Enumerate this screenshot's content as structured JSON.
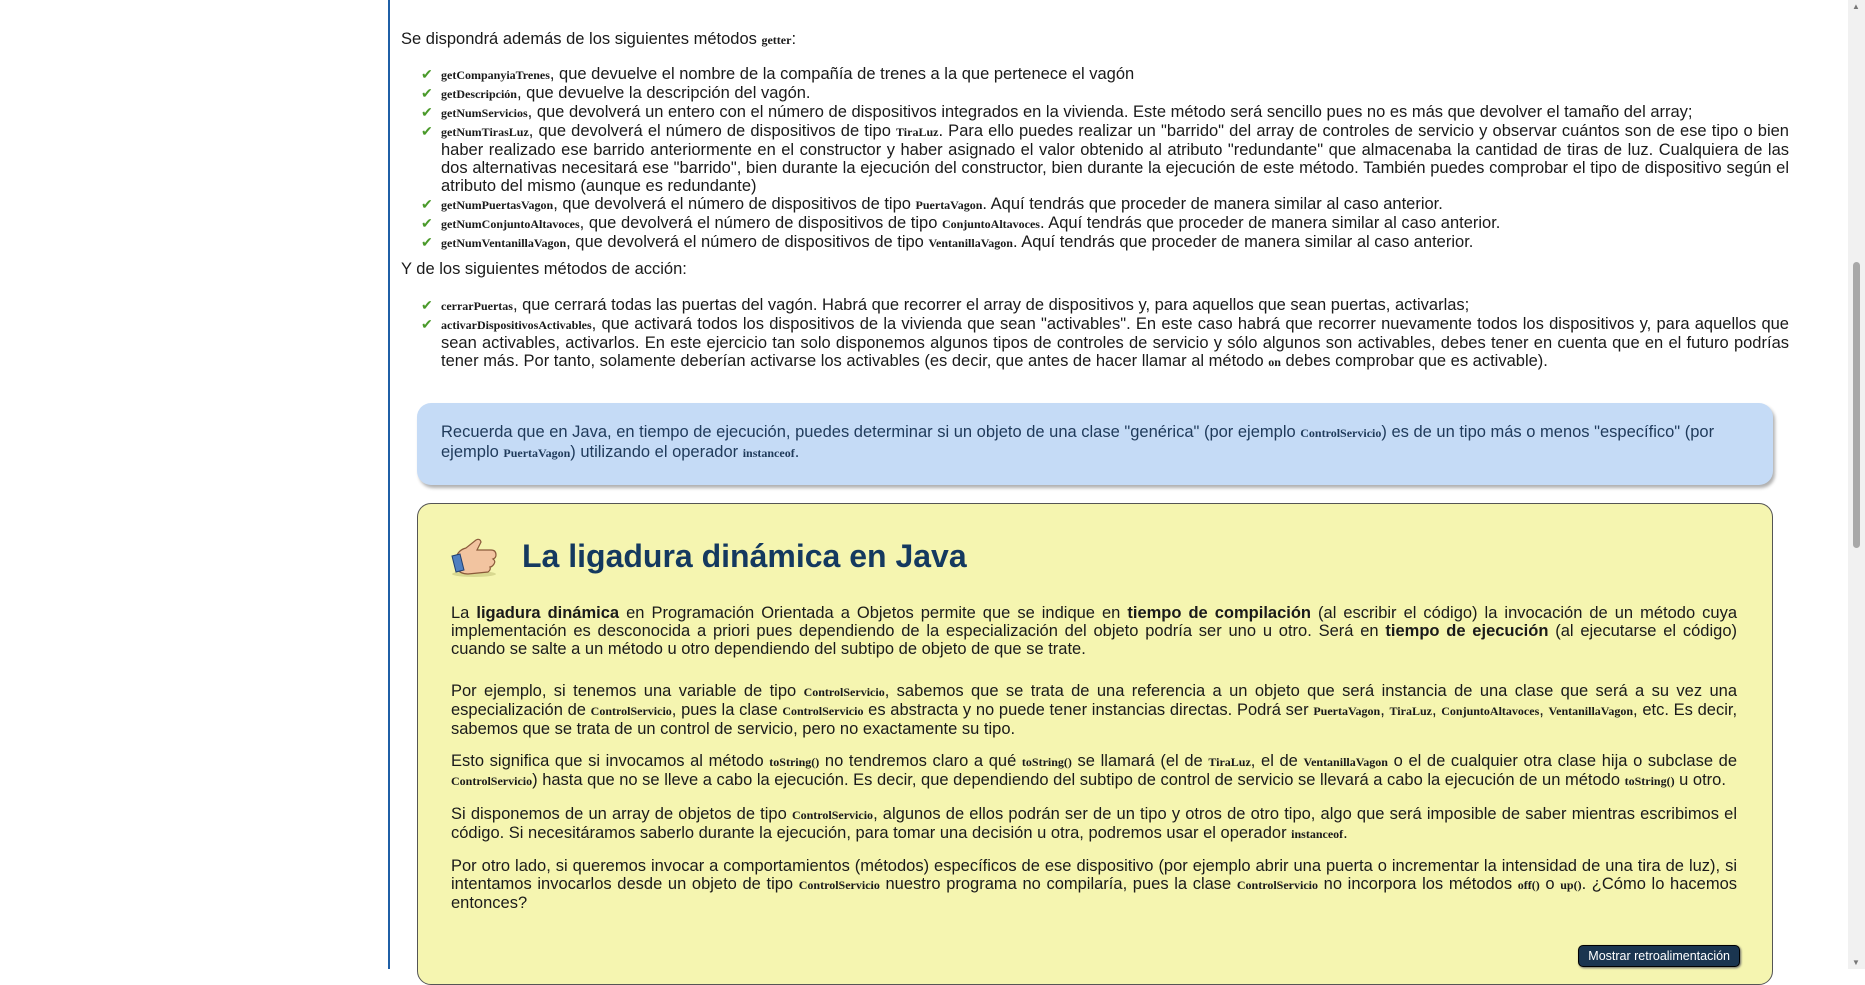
{
  "intro": {
    "before": "Se dispondrá además de los siguientes métodos ",
    "code": "getter",
    "after": ":"
  },
  "getters": [
    {
      "name": "getCompanyiaTrenes",
      "text": ", que devuelve el nombre de la compañía de  trenes a la que pertenece el vagón"
    },
    {
      "name": "getDescripción",
      "text": ", que devuelve la descripción del vagón."
    },
    {
      "name": "getNumServicios",
      "text": ", que devolverá un entero con el número de dispositivos integrados en la vivienda. Este método será sencillo pues no es más que devolver el tamaño del array;"
    },
    {
      "name": "getNumTirasLuz",
      "text": ", que devolverá el número de dispositivos de tipo ",
      "code2": "TiraLuz",
      "text2": ". Para ello puedes realizar un \"barrido\" del array de controles de servicio y observar cuántos son de ese tipo o bien haber realizado ese barrido anteriormente en el constructor y haber asignado el valor obtenido al atributo \"redundante\" que almacenaba la cantidad de tiras de luz. Cualquiera de las dos alternativas necesitará ese \"barrido\", bien durante la ejecución del constructor, bien durante la ejecución de este método. También puedes comprobar el tipo de dispositivo según el atributo del mismo (aunque es redundante)"
    },
    {
      "name": "getNumPuertasVagon",
      "text": ", que devolverá el número de dispositivos de tipo ",
      "code2": "PuertaVagon",
      "text2": ". Aquí tendrás que proceder de manera similar al caso anterior."
    },
    {
      "name": "getNumConjuntoAltavoces",
      "text": ", que devolverá el número de dispositivos de tipo ",
      "code2": "ConjuntoAltavoces",
      "text2": ". Aquí tendrás que proceder de manera similar al caso anterior."
    },
    {
      "name": "getNumVentanillaVagon",
      "text": ", que devolverá el número de dispositivos de tipo ",
      "code2": "VentanillaVagon",
      "text2": ". Aquí tendrás que proceder de manera similar al caso anterior."
    }
  ],
  "intro2": "Y de los siguientes métodos de acción:",
  "actions": [
    {
      "name": "cerrarPuertas",
      "text": ", que cerrará todas las puertas del vagón. Habrá que recorrer el array de dispositivos y, para  aquellos que sean puertas, activarlas;"
    },
    {
      "name": "activarDispositivosActivables",
      "text": ", que activará todos los dispositivos de la vivienda que sean \"activables\". En este caso habrá que recorrer nuevamente todos los dispositivos y, para aquellos que sean activables, activarlos. En este  ejercicio tan solo disponemos algunos tipos de controles de servicio y sólo algunos son activables, debes tener en cuenta que en el futuro podrías tener más. Por tanto, solamente deberían activarse los activables (es decir, que antes de hacer llamar al método ",
      "code2": "on",
      "text2": " debes comprobar que es activable)."
    }
  ],
  "note": {
    "t1": "Recuerda que en Java, en tiempo de ejecución, puedes determinar si un objeto de una clase \"genérica\" (por ejemplo ",
    "c1": "ControlServicio",
    "t2": ") es de un tipo más o menos \"específico\" (por ejemplo ",
    "c2": "PuertaVagon",
    "t3": ") utilizando el operador ",
    "c3": "instanceof",
    "t4": "."
  },
  "box": {
    "title": "La ligadura dinámica en Java",
    "p1": {
      "t1": "La ",
      "b1": "ligadura dinámica",
      "t2": " en Programación Orientada a Objetos permite que se indique en ",
      "b2": "tiempo de compilación",
      "t3": " (al escribir el código) la invocación de un método cuya implementación es desconocida a priori pues dependiendo de la especialización del objeto podría ser uno u otro. Será en ",
      "b3": "tiempo de ejecución",
      "t4": " (al ejecutarse el código) cuando se salte a un método u otro dependiendo del subtipo de objeto de que se trate."
    },
    "p2": {
      "t1": "Por ejemplo, si tenemos una variable de tipo ",
      "c1": "ControlServicio",
      "t2": ", sabemos que se trata de una referencia a un objeto que será instancia de una clase que será a su vez una especialización de ",
      "c2": "ControlServicio",
      "t3": ", pues la clase ",
      "c3": "ControlServicio",
      "t4": " es abstracta y no puede tener instancias directas. Podrá ser ",
      "c4": "PuertaVagon",
      "t5": ", ",
      "c5": "TiraLuz",
      "t6": ", ",
      "c6": "ConjuntoAltavoces",
      "t7": ", ",
      "c7": "VentanillaVagon",
      "t8": ", etc. Es decir, sabemos que se trata de un control de servicio, pero no exactamente su tipo."
    },
    "p3": {
      "t1": "Esto significa que si invocamos al método ",
      "c1": "toString()",
      "t2": " no tendremos claro a qué ",
      "c2": "toString()",
      "t3": " se llamará (el de ",
      "c3": "TiraLuz",
      "t4": ", el de ",
      "c4": "VentanillaVagon",
      "t5": " o el de cualquier otra clase hija o subclase de ",
      "c5": "ControlServicio",
      "t6": ") hasta que no se lleve a cabo la ejecución. Es decir, que dependiendo del subtipo de control de servicio se llevará a cabo la ejecución de un método ",
      "c6": "toString()",
      "t7": " u otro."
    },
    "p4": {
      "t1": "Si disponemos de un array de objetos de tipo ",
      "c1": "ControlServicio",
      "t2": ", algunos de ellos podrán ser de un tipo y otros de otro tipo, algo que será imposible de saber mientras escribimos el código. Si necesitáramos saberlo durante la ejecución, para tomar una decisión u otra, podremos usar el operador ",
      "c2": "instanceof",
      "t3": "."
    },
    "p5": {
      "t1": "Por otro lado, si queremos invocar a comportamientos (métodos) específicos de ese dispositivo (por ejemplo abrir una puerta o incrementar la intensidad de una tira de luz), si intentamos invocarlos desde un objeto de tipo ",
      "c1": "ControlServicio",
      "t2": " nuestro programa no compilaría, pues la clase ",
      "c2": "ControlServicio",
      "t3": " no incorpora los métodos ",
      "c3": "off()",
      "t4": " o ",
      "c4": "up()",
      "t5": ". ¿Cómo lo hacemos entonces?"
    },
    "feedback_button": "Mostrar retroalimentación"
  }
}
